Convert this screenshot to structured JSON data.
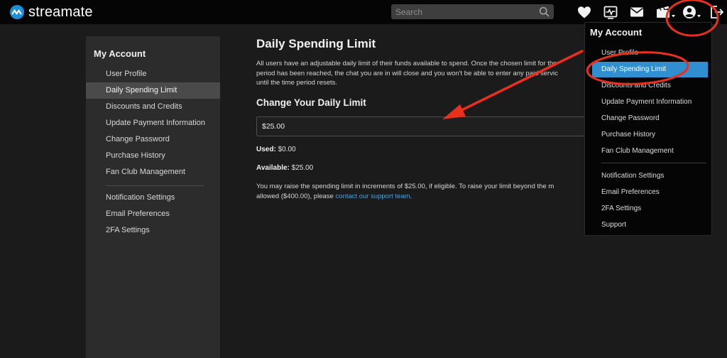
{
  "brand": {
    "name": "streamate"
  },
  "search": {
    "placeholder": "Search"
  },
  "sidebar": {
    "title": "My Account",
    "items": [
      {
        "label": "User Profile"
      },
      {
        "label": "Daily Spending Limit",
        "active": true
      },
      {
        "label": "Discounts and Credits"
      },
      {
        "label": "Update Payment Information"
      },
      {
        "label": "Change Password"
      },
      {
        "label": "Purchase History"
      },
      {
        "label": "Fan Club Management"
      },
      {
        "label": "Notification Settings"
      },
      {
        "label": "Email Preferences"
      },
      {
        "label": "2FA Settings"
      }
    ]
  },
  "main": {
    "title": "Daily Spending Limit",
    "intro_line1": "All users have an adjustable daily limit of their funds available to spend. Once the chosen limit for the",
    "intro_line2": "period has been reached, the chat you are in will close and you won't be able to enter any paid servic",
    "intro_line3": "until the time period resets.",
    "change_title": "Change Your Daily Limit",
    "limit_value": "$25.00",
    "used_label": "Used:",
    "used_value": "$0.00",
    "available_label": "Available:",
    "available_value": "$25.00",
    "raise_line1": "You may raise the spending limit in increments of $25.00, if eligible. To raise your limit beyond the m",
    "raise_line2_prefix": "allowed ($400.00), please",
    "support_link": "contact our support team",
    "raise_line2_suffix": "."
  },
  "dropdown": {
    "title": "My Account",
    "items": [
      {
        "label": "User Profile"
      },
      {
        "label": "Daily Spending Limit",
        "active": true
      },
      {
        "label": "Discounts and Credits"
      },
      {
        "label": "Update Payment Information"
      },
      {
        "label": "Change Password"
      },
      {
        "label": "Purchase History"
      },
      {
        "label": "Fan Club Management"
      },
      {
        "label": "Notification Settings"
      },
      {
        "label": "Email Preferences"
      },
      {
        "label": "2FA Settings"
      },
      {
        "label": "Support"
      }
    ]
  },
  "icons": {
    "favorites": "heart-icon",
    "activity": "activity-monitor-icon",
    "messages": "mail-icon",
    "media": "clapperboard-icon",
    "account": "user-circle-icon",
    "logout": "logout-icon"
  },
  "colors": {
    "accent": "#2f8fd1",
    "link": "#4aa3d8",
    "annotation": "#e8301c",
    "background": "#1b1b1b",
    "sidebar": "#2c2c2c"
  }
}
